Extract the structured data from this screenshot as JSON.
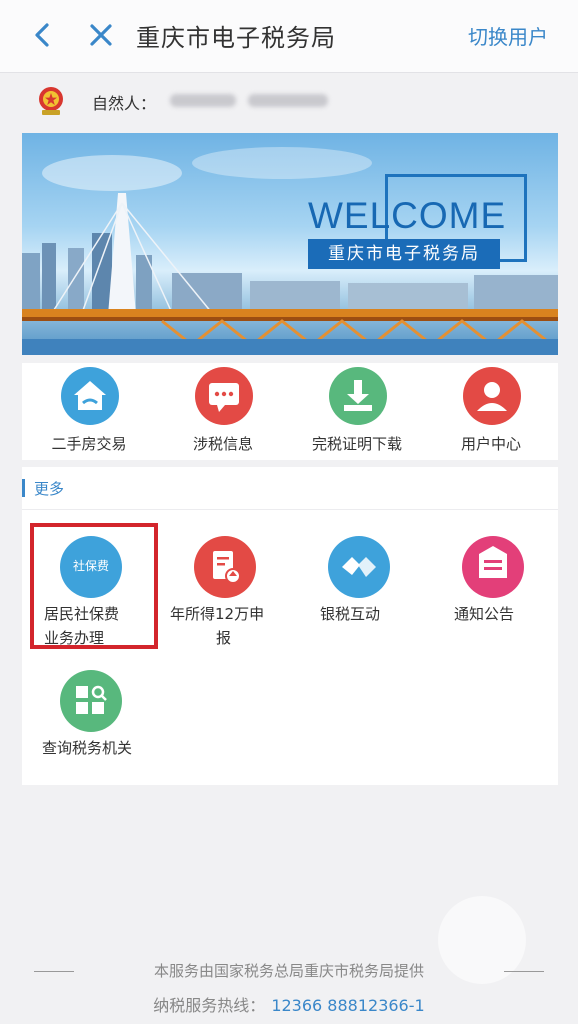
{
  "header": {
    "title": "重庆市电子税务局",
    "switch_user": "切换用户"
  },
  "user": {
    "label": "自然人："
  },
  "banner": {
    "welcome": "WELCOME",
    "subtitle": "重庆市电子税务局"
  },
  "quick_icons": [
    {
      "label": "二手房交易",
      "icon": "house-icon",
      "color": "#3ea2db"
    },
    {
      "label": "涉税信息",
      "icon": "message-icon",
      "color": "#e34a45"
    },
    {
      "label": "完税证明下载",
      "icon": "download-icon",
      "color": "#58b87d"
    },
    {
      "label": "用户中心",
      "icon": "user-icon",
      "color": "#e34a45"
    }
  ],
  "more": {
    "title": "更多",
    "items": [
      {
        "label": "居民社保费业务办理",
        "line1": "居民社保费",
        "line2": "业务办理",
        "badge": "社保费",
        "icon": "social-insurance-icon",
        "color": "#3ea2db"
      },
      {
        "label": "年所得12万申报",
        "line1": "年所得12万申",
        "line2": "报",
        "icon": "tax-report-icon",
        "color": "#e34a45"
      },
      {
        "label": "银税互动",
        "line1": "银税互动",
        "icon": "handshake-icon",
        "color": "#3ea2db"
      },
      {
        "label": "通知公告",
        "line1": "通知公告",
        "icon": "notice-icon",
        "color": "#e33f79"
      },
      {
        "label": "查询税务机关",
        "line1": "查询税务机关",
        "icon": "search-office-icon",
        "color": "#58b87d"
      }
    ]
  },
  "footer": {
    "line1": "本服务由国家税务总局重庆市税务局提供",
    "hotline_label": "纳税服务热线：",
    "hotline_numbers": "12366  88812366-1"
  },
  "colors": {
    "accent": "#3a87c9",
    "highlight_border": "#d3252c"
  }
}
